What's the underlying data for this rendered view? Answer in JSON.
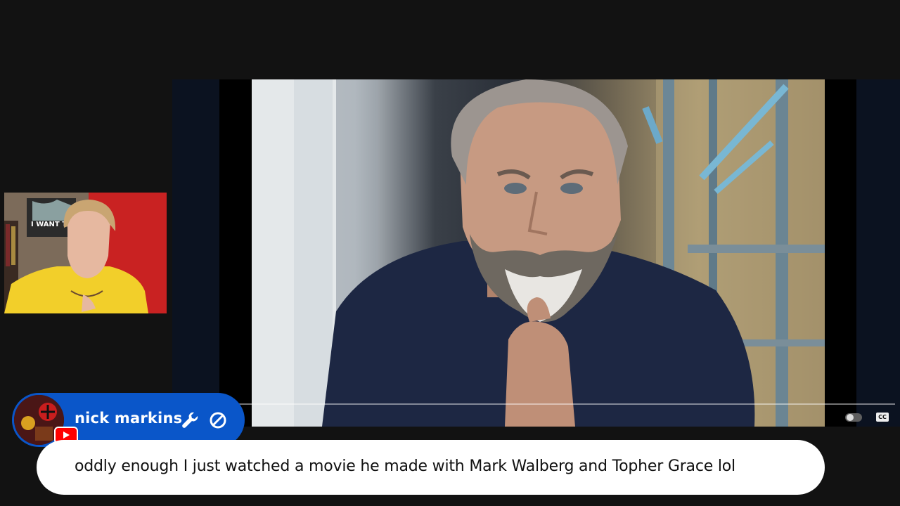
{
  "video": {
    "controls": {
      "captions_label": "CC",
      "pause_icon": "pause-toggle-icon"
    }
  },
  "webcam": {
    "poster_text": "I WANT TO BELIEVE"
  },
  "chat": {
    "author_name": "nick markins",
    "message": "oddly enough I just watched a movie he made with Mark Walberg and Topher Grace lol",
    "icons": [
      "wrench-icon",
      "ban-icon",
      "youtube-icon"
    ],
    "colors": {
      "header_bg": "#0a56c9",
      "bubble_bg": "#ffffff",
      "youtube_red": "#ff0000"
    }
  }
}
